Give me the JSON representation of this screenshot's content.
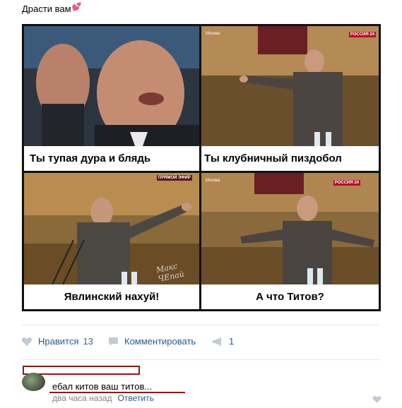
{
  "post": {
    "text": "Драсти вам",
    "emoji": "💕"
  },
  "comic": {
    "panels": [
      {
        "caption": "Ты тупая дура и блядь"
      },
      {
        "caption": "Ты клубничный пиздобол",
        "channel_place": "Москва",
        "channel_logo": "РОССИЯ 24"
      },
      {
        "caption": "Явлинский нахуй!",
        "channel_logo": "ПРЯМОЙ ЭФИР",
        "watermark": "Макс ЧЕпай"
      },
      {
        "caption": "А что Титов?",
        "channel_place": "Москва",
        "channel_logo": "РОССИЯ 24"
      }
    ]
  },
  "actions": {
    "like_label": "Нравится",
    "like_count": "13",
    "comment_label": "Комментировать",
    "share_count": "1"
  },
  "comment": {
    "text": "ебал китов ваш титов...",
    "time": "два часа назад",
    "reply_label": "Ответить"
  },
  "colors": {
    "link": "#2a5885",
    "icon": "#c2cad5",
    "muted": "#828282",
    "redact": "#8b1a1a"
  }
}
